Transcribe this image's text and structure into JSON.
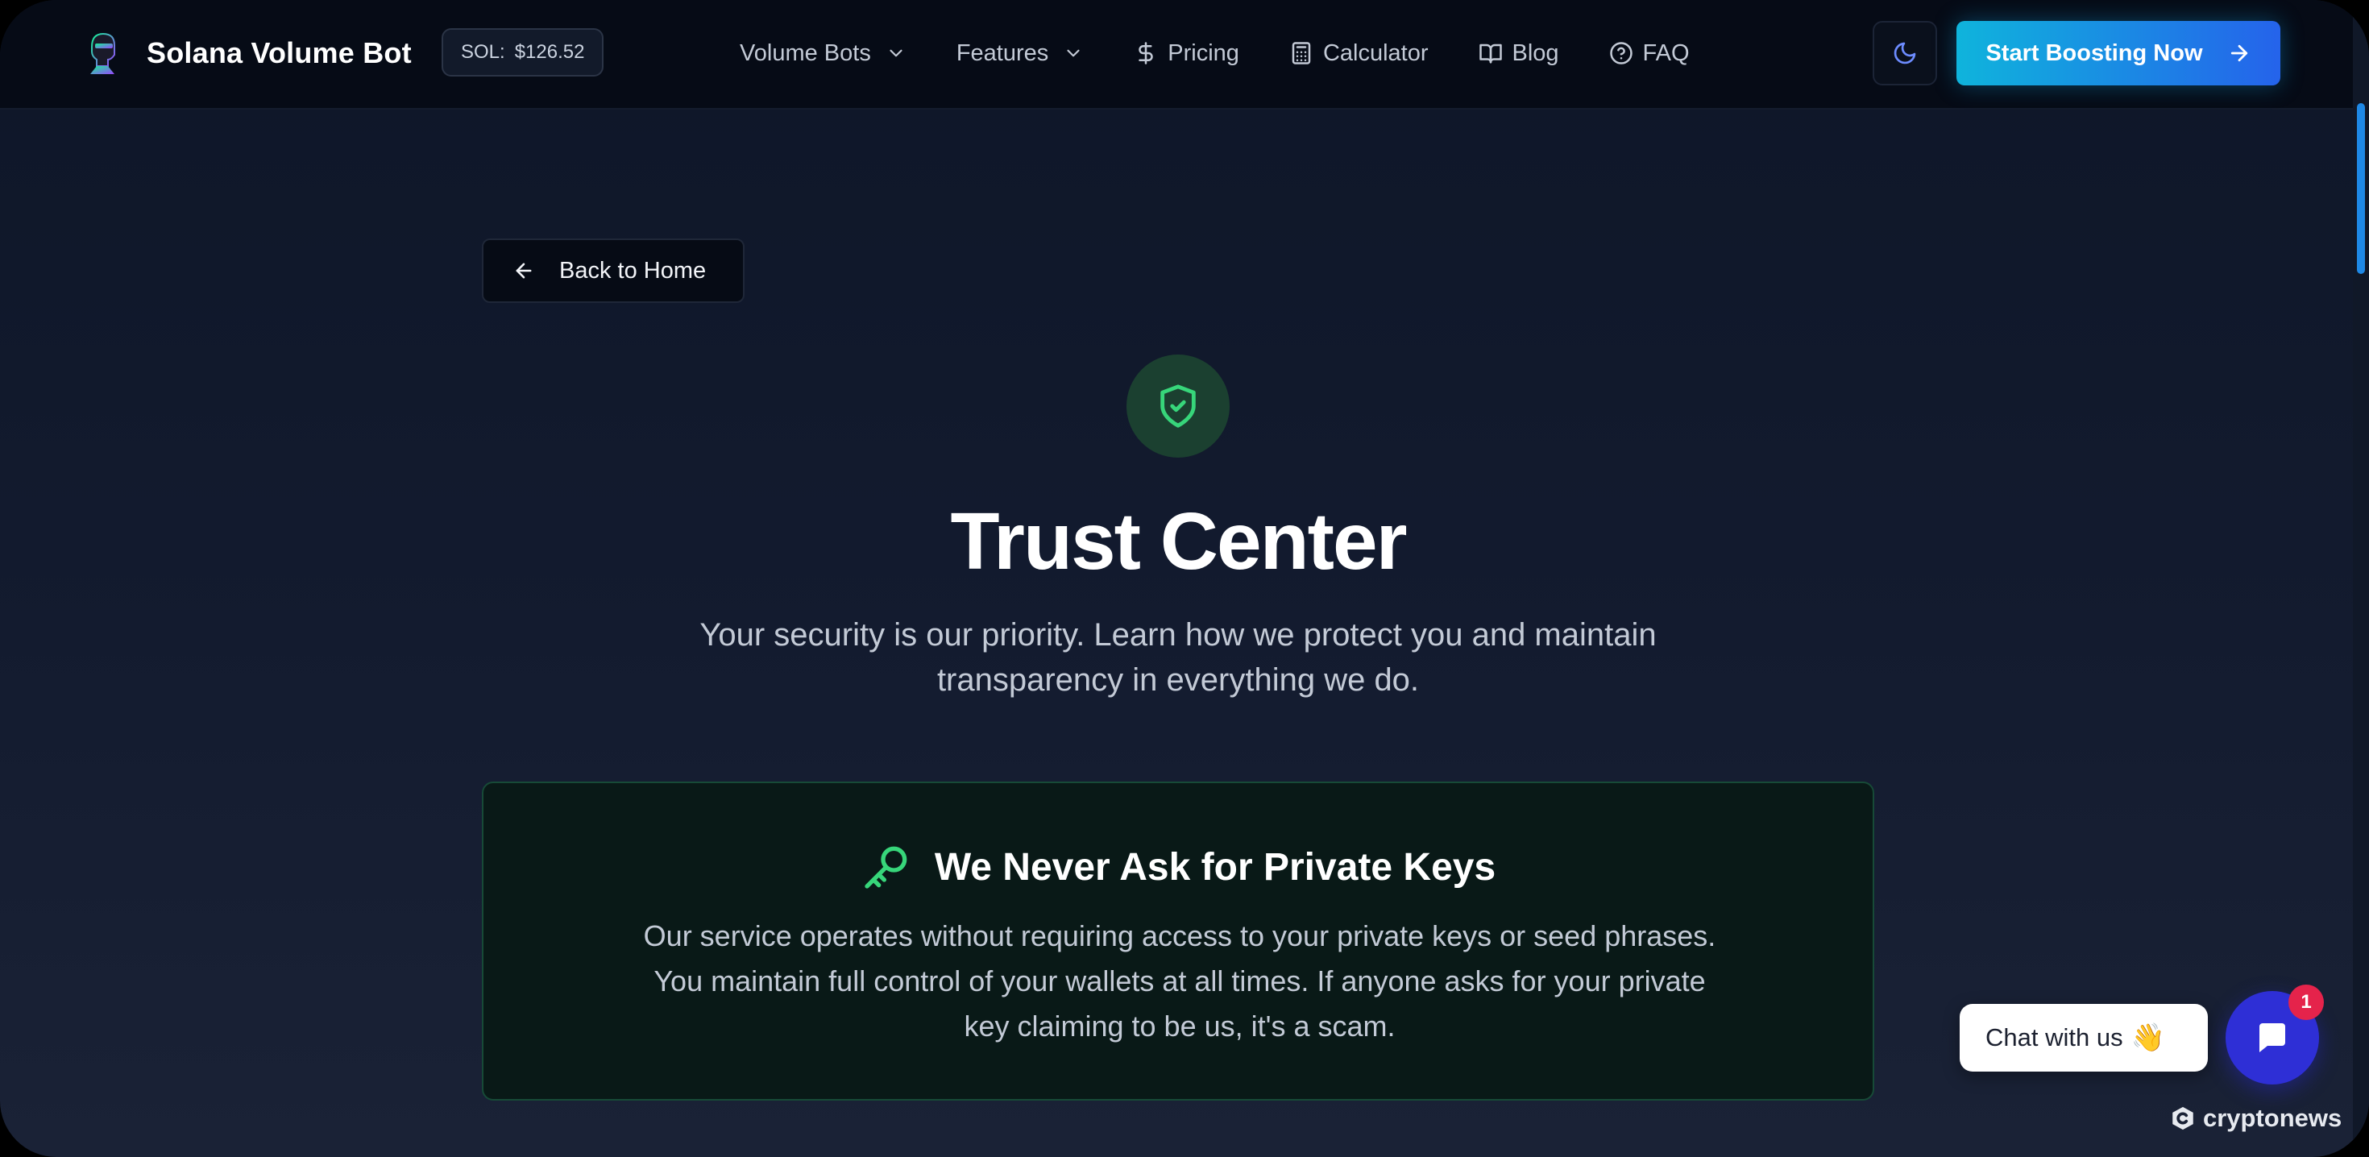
{
  "navbar": {
    "brand_name": "Solana Volume Bot",
    "sol_price": {
      "label": "SOL:",
      "value": "$126.52"
    },
    "links": [
      {
        "label": "Volume Bots",
        "icon": "chevron-down-icon"
      },
      {
        "label": "Features",
        "icon": "chevron-down-icon"
      },
      {
        "label": "Pricing",
        "icon": "dollar-sign-icon"
      },
      {
        "label": "Calculator",
        "icon": "calculator-icon"
      },
      {
        "label": "Blog",
        "icon": "book-open-icon"
      },
      {
        "label": "FAQ",
        "icon": "help-circle-icon"
      }
    ],
    "theme_toggle_icon": "moon-icon",
    "cta_label": "Start Boosting Now",
    "cta_icon": "arrow-right-icon"
  },
  "main": {
    "back_label": "Back to Home",
    "hero_icon": "shield-check-icon",
    "title": "Trust Center",
    "subtitle": "Your security is our priority. Learn how we protect you and maintain transparency in everything we do.",
    "keys_card": {
      "icon": "key-icon",
      "heading": "We Never Ask for Private Keys",
      "body": "Our service operates without requiring access to your private keys or seed phrases. You maintain full control of your wallets at all times. If anyone asks for your private key claiming to be us, it's a scam."
    }
  },
  "chat": {
    "bubble_text": "Chat with us",
    "wave_emoji": "👋",
    "unread_count": "1"
  },
  "watermark": {
    "text": "cryptonews"
  },
  "colors": {
    "accent_gradient_start": "#0fb4dc",
    "accent_gradient_end": "#2563eb",
    "success_green": "#37d67a",
    "chat_blue": "#2e2fd6",
    "badge_red": "#e5234b",
    "page_bg": "#131b2f"
  }
}
